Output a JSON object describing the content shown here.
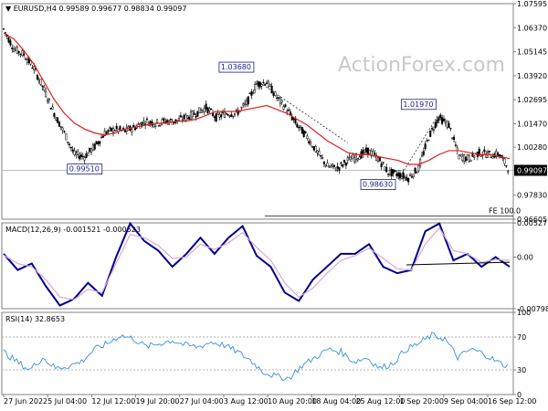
{
  "chart_data": [
    {
      "type": "candlestick",
      "panel": "price",
      "header": {
        "symbol": "EURUSD,H4",
        "open": "0.99589",
        "high": "0.99677",
        "low": "0.98834",
        "close": "0.99097"
      },
      "watermark": "ActionForex.com",
      "y_ticks": [
        "1.07595",
        "1.06370",
        "1.05145",
        "1.03920",
        "1.02695",
        "1.01470",
        "1.00280",
        "0.99097",
        "0.97830",
        "0.96605"
      ],
      "ylim": [
        0.96605,
        1.07595
      ],
      "current_price_label": "0.99097",
      "annotations": [
        {
          "label": "1.03680",
          "value": 1.0368
        },
        {
          "label": "0.99510",
          "value": 0.9951
        },
        {
          "label": "1.01970",
          "value": 1.0197
        },
        {
          "label": "0.98630",
          "value": 0.9863
        }
      ],
      "fe_label": "FE 100.0",
      "fe_level": 0.9677,
      "moving_average_color": "#e02020",
      "close_path": [
        1.063,
        1.053,
        1.05,
        1.043,
        1.032,
        1.02,
        1.01,
        0.999,
        0.998,
        1.003,
        1.01,
        1.012,
        1.011,
        1.013,
        1.016,
        1.015,
        1.016,
        1.016,
        1.018,
        1.02,
        1.023,
        1.018,
        1.02,
        1.02,
        1.025,
        1.035,
        1.036,
        1.028,
        1.022,
        1.014,
        1.008,
        1.0,
        0.993,
        0.992,
        0.996,
        0.998,
        1.001,
        0.997,
        0.99,
        0.989,
        0.987,
        0.992,
        1.008,
        1.018,
        1.014,
        0.998,
        0.997,
        1.0,
        0.999,
        0.999,
        0.991
      ],
      "ma_path": [
        1.061,
        1.058,
        1.052,
        1.045,
        1.036,
        1.027,
        1.02,
        1.015,
        1.012,
        1.01,
        1.009,
        1.01,
        1.012,
        1.013,
        1.014,
        1.015,
        1.015,
        1.016,
        1.016,
        1.017,
        1.019,
        1.021,
        1.021,
        1.021,
        1.022,
        1.023,
        1.024,
        1.022,
        1.02,
        1.017,
        1.014,
        1.01,
        1.006,
        1.003,
        1.0,
        0.999,
        0.999,
        0.998,
        0.997,
        0.996,
        0.994,
        0.994,
        0.996,
        0.999,
        1.001,
        1.001,
        1.0,
        0.999,
        0.999,
        0.998,
        0.997
      ]
    },
    {
      "type": "line",
      "panel": "macd",
      "title": "MACD(12,26,9) -0.001521 -0.000523",
      "y_ticks": [
        "0.00527",
        "0.00",
        "-0.007984"
      ],
      "ylim": [
        -0.008,
        0.0053
      ],
      "series": [
        {
          "color": "#00008b",
          "values": [
            0.0005,
            -0.002,
            -0.001,
            -0.0045,
            -0.0075,
            -0.0065,
            -0.004,
            -0.006,
            0.0,
            0.0052,
            0.0025,
            0.001,
            -0.0015,
            0.0005,
            0.003,
            0.0005,
            0.003,
            0.0048,
            0.0002,
            -0.0015,
            -0.0055,
            -0.0068,
            -0.0035,
            -0.0015,
            0.0005,
            0.0005,
            0.002,
            -0.0015,
            -0.0025,
            -0.002,
            0.004,
            0.0052,
            -0.0005,
            0.0005,
            -0.0015,
            0.0,
            -0.0015
          ]
        },
        {
          "color": "#d8a8d8",
          "values": [
            0.0003,
            -0.001,
            -0.0015,
            -0.0035,
            -0.0062,
            -0.0066,
            -0.005,
            -0.0055,
            -0.001,
            0.0035,
            0.003,
            0.0018,
            -0.0002,
            0.0,
            0.002,
            0.0012,
            0.0022,
            0.0038,
            0.0015,
            -0.0005,
            -0.004,
            -0.0062,
            -0.0048,
            -0.0025,
            -0.0005,
            0.0002,
            0.0014,
            -0.0002,
            -0.0018,
            -0.002,
            0.002,
            0.0045,
            0.001,
            0.0005,
            -0.0008,
            -0.0004,
            -0.0005
          ]
        }
      ]
    },
    {
      "type": "line",
      "panel": "rsi",
      "title": "RSI(14) 32.8653",
      "y_ticks": [
        "100",
        "70",
        "30",
        "0"
      ],
      "ylim": [
        0,
        100
      ],
      "series": [
        {
          "color": "#3a8fe0",
          "values": [
            52,
            40,
            30,
            45,
            32,
            35,
            40,
            55,
            62,
            72,
            68,
            58,
            62,
            66,
            60,
            58,
            64,
            60,
            52,
            42,
            28,
            22,
            20,
            35,
            45,
            55,
            52,
            40,
            45,
            32,
            38,
            55,
            62,
            72,
            68,
            45,
            55,
            50,
            40,
            33
          ]
        }
      ]
    },
    {
      "type": "axis",
      "panel": "time",
      "x_ticks": [
        "27 Jun 2022",
        "5 Jul 04:00",
        "12 Jul 12:00",
        "19 Jul 20:00",
        "27 Jul 04:00",
        "3 Aug 12:00",
        "10 Aug 20:00",
        "18 Aug 04:00",
        "25 Aug 12:00",
        "1 Sep 20:00",
        "9 Sep 04:00",
        "16 Sep 12:00"
      ]
    }
  ]
}
